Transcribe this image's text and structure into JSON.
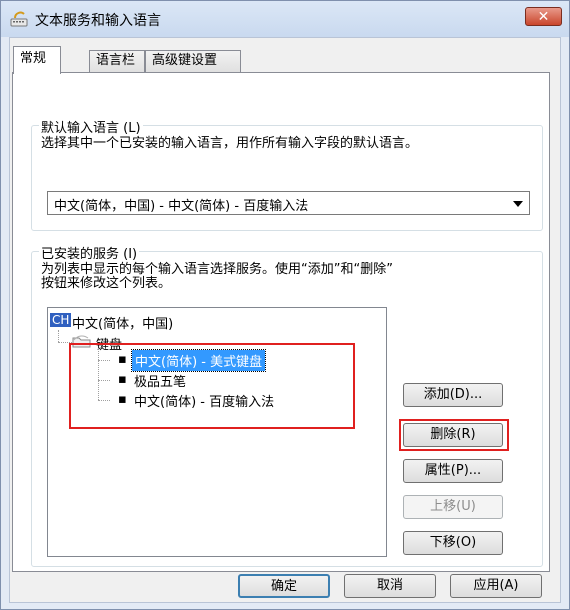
{
  "window": {
    "title": "文本服务和输入语言",
    "close": "✕"
  },
  "tabs": [
    "常规",
    "语言栏",
    "高级键设置"
  ],
  "default_lang": {
    "label": "默认输入语言 (L)",
    "desc": "选择其中一个已安装的输入语言，用作所有输入字段的默认语言。",
    "selected": "中文(简体，中国) - 中文(简体) - 百度输入法"
  },
  "services": {
    "label": "已安装的服务 (I)",
    "desc_line1": "为列表中显示的每个输入语言选择服务。使用“添加”和“删除”",
    "desc_line2": "按钮来修改这个列表。",
    "lang_badge": "CH",
    "lang_name": "中文(简体，中国)",
    "keyboard_label": "键盘",
    "items": [
      "中文(简体) - 美式键盘",
      "极品五笔",
      "中文(简体) - 百度输入法"
    ],
    "buttons": {
      "add": "添加(D)...",
      "remove": "删除(R)",
      "properties": "属性(P)...",
      "move_up": "上移(U)",
      "move_down": "下移(O)"
    }
  },
  "footer": {
    "ok": "确定",
    "cancel": "取消",
    "apply": "应用(A)"
  },
  "colors": {
    "highlight": "#3399ff",
    "annotation_red": "#e0201f"
  }
}
